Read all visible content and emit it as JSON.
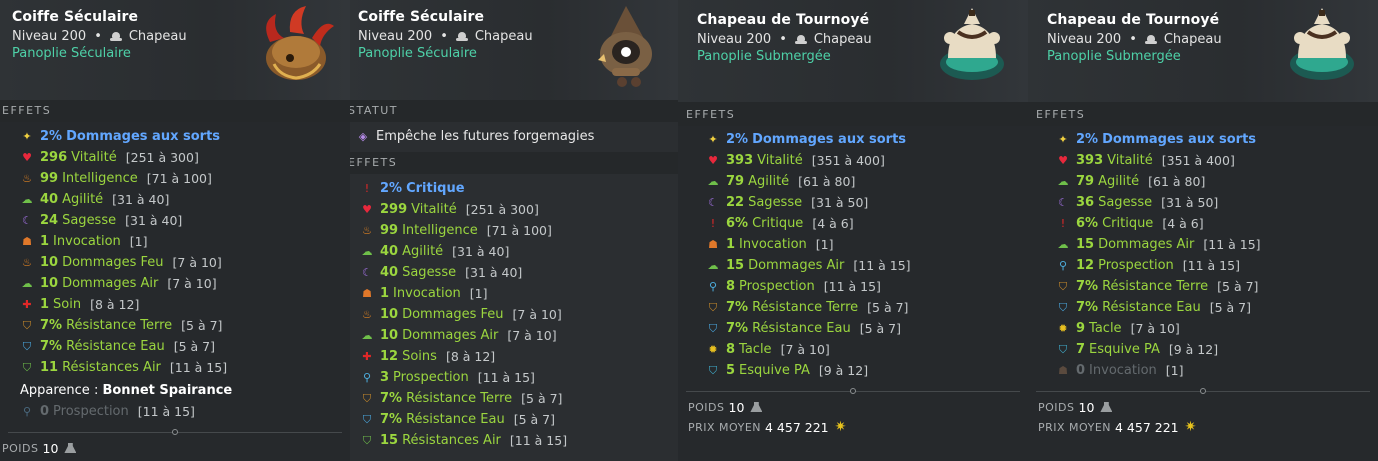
{
  "colors": {
    "green": "#9bd63f",
    "blue": "#62a7ff",
    "set": "#4ed1a8",
    "grey": "#646a6e"
  },
  "panels": [
    {
      "name": "Coiffe Séculaire",
      "level": "Niveau 200",
      "type": "Chapeau",
      "set": "Panoplie Séculaire",
      "effects_title": "EFFETS",
      "effects": [
        {
          "icon": "star-icon",
          "value": "2%",
          "stat": "Dommages aux sorts",
          "range": "",
          "color": "blue"
        },
        {
          "icon": "heart-icon",
          "value": "296",
          "stat": "Vitalité",
          "range": "[251 à 300]",
          "color": "green"
        },
        {
          "icon": "fire-icon",
          "value": "99",
          "stat": "Intelligence",
          "range": "[71 à 100]",
          "color": "green"
        },
        {
          "icon": "air-icon",
          "value": "40",
          "stat": "Agilité",
          "range": "[31 à 40]",
          "color": "green"
        },
        {
          "icon": "moon-icon",
          "value": "24",
          "stat": "Sagesse",
          "range": "[31 à 40]",
          "color": "green"
        },
        {
          "icon": "summon-icon",
          "value": "1",
          "stat": "Invocation",
          "range": "[1]",
          "color": "green"
        },
        {
          "icon": "fire-icon",
          "value": "10",
          "stat": "Dommages Feu",
          "range": "[7 à 10]",
          "color": "green"
        },
        {
          "icon": "air-icon",
          "value": "10",
          "stat": "Dommages Air",
          "range": "[7 à 10]",
          "color": "green"
        },
        {
          "icon": "cross-icon",
          "value": "1",
          "stat": "Soin",
          "range": "[8 à 12]",
          "color": "green"
        },
        {
          "icon": "shield-earth-icon",
          "value": "7%",
          "stat": "Résistance Terre",
          "range": "[5 à 7]",
          "color": "green"
        },
        {
          "icon": "shield-water-icon",
          "value": "7%",
          "stat": "Résistance Eau",
          "range": "[5 à 7]",
          "color": "green"
        },
        {
          "icon": "shield-air-icon",
          "value": "11",
          "stat": "Résistances Air",
          "range": "[11 à 15]",
          "color": "green"
        }
      ],
      "appearance_label": "Apparence :",
      "appearance_value": "Bonnet Spairance",
      "extra": {
        "icon": "magnifier-icon",
        "value": "0",
        "stat": "Prospection",
        "range": "[11 à 15]",
        "color": "grey"
      },
      "weight_label": "POIDS",
      "weight_value": "10"
    },
    {
      "name": "Coiffe Séculaire",
      "level": "Niveau 200",
      "type": "Chapeau",
      "set": "Panoplie Séculaire",
      "status_title": "STATUT",
      "status_text": "Empêche les futures forgemagies",
      "effects_title": "EFFETS",
      "effects": [
        {
          "icon": "exclaim-icon",
          "value": "2%",
          "stat": "Critique",
          "range": "",
          "color": "blue"
        },
        {
          "icon": "heart-icon",
          "value": "299",
          "stat": "Vitalité",
          "range": "[251 à 300]",
          "color": "green"
        },
        {
          "icon": "fire-icon",
          "value": "99",
          "stat": "Intelligence",
          "range": "[71 à 100]",
          "color": "green"
        },
        {
          "icon": "air-icon",
          "value": "40",
          "stat": "Agilité",
          "range": "[31 à 40]",
          "color": "green"
        },
        {
          "icon": "moon-icon",
          "value": "40",
          "stat": "Sagesse",
          "range": "[31 à 40]",
          "color": "green"
        },
        {
          "icon": "summon-icon",
          "value": "1",
          "stat": "Invocation",
          "range": "[1]",
          "color": "green"
        },
        {
          "icon": "fire-icon",
          "value": "10",
          "stat": "Dommages Feu",
          "range": "[7 à 10]",
          "color": "green"
        },
        {
          "icon": "air-icon",
          "value": "10",
          "stat": "Dommages Air",
          "range": "[7 à 10]",
          "color": "green"
        },
        {
          "icon": "cross-icon",
          "value": "12",
          "stat": "Soins",
          "range": "[8 à 12]",
          "color": "green"
        },
        {
          "icon": "magnifier-icon",
          "value": "3",
          "stat": "Prospection",
          "range": "[11 à 15]",
          "color": "green"
        },
        {
          "icon": "shield-earth-icon",
          "value": "7%",
          "stat": "Résistance Terre",
          "range": "[5 à 7]",
          "color": "green"
        },
        {
          "icon": "shield-water-icon",
          "value": "7%",
          "stat": "Résistance Eau",
          "range": "[5 à 7]",
          "color": "green"
        },
        {
          "icon": "shield-air-icon",
          "value": "15",
          "stat": "Résistances Air",
          "range": "[11 à 15]",
          "color": "green"
        }
      ]
    },
    {
      "name": "Chapeau de Tournoyé",
      "level": "Niveau 200",
      "type": "Chapeau",
      "set": "Panoplie Submergée",
      "effects_title": "EFFETS",
      "effects": [
        {
          "icon": "star-icon",
          "value": "2%",
          "stat": "Dommages aux sorts",
          "range": "",
          "color": "blue"
        },
        {
          "icon": "heart-icon",
          "value": "393",
          "stat": "Vitalité",
          "range": "[351 à 400]",
          "color": "green"
        },
        {
          "icon": "air-icon",
          "value": "79",
          "stat": "Agilité",
          "range": "[61 à 80]",
          "color": "green"
        },
        {
          "icon": "moon-icon",
          "value": "22",
          "stat": "Sagesse",
          "range": "[31 à 50]",
          "color": "green"
        },
        {
          "icon": "exclaim-icon",
          "value": "6%",
          "stat": "Critique",
          "range": "[4 à 6]",
          "color": "green"
        },
        {
          "icon": "summon-icon",
          "value": "1",
          "stat": "Invocation",
          "range": "[1]",
          "color": "green"
        },
        {
          "icon": "air-icon",
          "value": "15",
          "stat": "Dommages Air",
          "range": "[11 à 15]",
          "color": "green"
        },
        {
          "icon": "magnifier-icon",
          "value": "8",
          "stat": "Prospection",
          "range": "[11 à 15]",
          "color": "green"
        },
        {
          "icon": "shield-earth-icon",
          "value": "7%",
          "stat": "Résistance Terre",
          "range": "[5 à 7]",
          "color": "green"
        },
        {
          "icon": "shield-water-icon",
          "value": "7%",
          "stat": "Résistance Eau",
          "range": "[5 à 7]",
          "color": "green"
        },
        {
          "icon": "tackle-icon",
          "value": "8",
          "stat": "Tacle",
          "range": "[7 à 10]",
          "color": "green"
        },
        {
          "icon": "shield-dodge-icon",
          "value": "5",
          "stat": "Esquive PA",
          "range": "[9 à 12]",
          "color": "green"
        }
      ],
      "weight_label": "POIDS",
      "weight_value": "10",
      "price_label": "PRIX MOYEN",
      "price_value": "4 457 221"
    },
    {
      "name": "Chapeau de Tournoyé",
      "level": "Niveau 200",
      "type": "Chapeau",
      "set": "Panoplie Submergée",
      "effects_title": "EFFETS",
      "effects": [
        {
          "icon": "star-icon",
          "value": "2%",
          "stat": "Dommages aux sorts",
          "range": "",
          "color": "blue"
        },
        {
          "icon": "heart-icon",
          "value": "393",
          "stat": "Vitalité",
          "range": "[351 à 400]",
          "color": "green"
        },
        {
          "icon": "air-icon",
          "value": "79",
          "stat": "Agilité",
          "range": "[61 à 80]",
          "color": "green"
        },
        {
          "icon": "moon-icon",
          "value": "36",
          "stat": "Sagesse",
          "range": "[31 à 50]",
          "color": "green"
        },
        {
          "icon": "exclaim-icon",
          "value": "6%",
          "stat": "Critique",
          "range": "[4 à 6]",
          "color": "green"
        },
        {
          "icon": "air-icon",
          "value": "15",
          "stat": "Dommages Air",
          "range": "[11 à 15]",
          "color": "green"
        },
        {
          "icon": "magnifier-icon",
          "value": "12",
          "stat": "Prospection",
          "range": "[11 à 15]",
          "color": "green"
        },
        {
          "icon": "shield-earth-icon",
          "value": "7%",
          "stat": "Résistance Terre",
          "range": "[5 à 7]",
          "color": "green"
        },
        {
          "icon": "shield-water-icon",
          "value": "7%",
          "stat": "Résistance Eau",
          "range": "[5 à 7]",
          "color": "green"
        },
        {
          "icon": "tackle-icon",
          "value": "9",
          "stat": "Tacle",
          "range": "[7 à 10]",
          "color": "green"
        },
        {
          "icon": "shield-dodge-icon",
          "value": "7",
          "stat": "Esquive PA",
          "range": "[9 à 12]",
          "color": "green"
        },
        {
          "icon": "summon-icon",
          "value": "0",
          "stat": "Invocation",
          "range": "[1]",
          "color": "grey"
        }
      ],
      "weight_label": "POIDS",
      "weight_value": "10",
      "price_label": "PRIX MOYEN",
      "price_value": "4 457 221"
    }
  ]
}
